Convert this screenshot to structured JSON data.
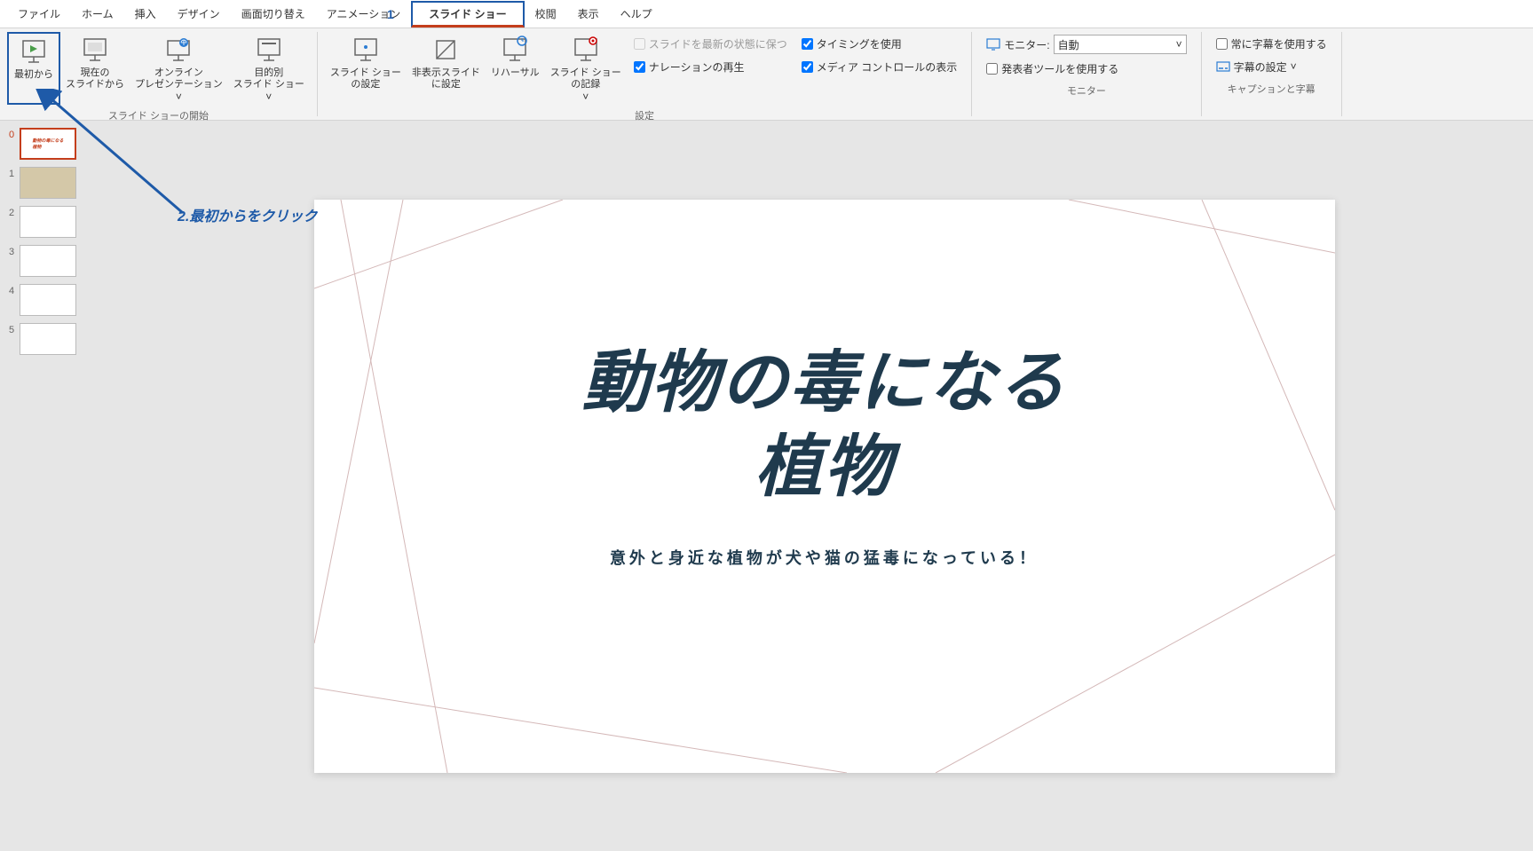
{
  "menubar": {
    "items": [
      "ファイル",
      "ホーム",
      "挿入",
      "デザイン",
      "画面切り替え",
      "アニメーション",
      "スライド ショー",
      "校閲",
      "表示",
      "ヘルプ"
    ],
    "active_index": 6,
    "annotation_1": "1"
  },
  "ribbon": {
    "start": {
      "from_beginning": "最初から",
      "from_current": "現在の\nスライドから",
      "online_presentation": "オンライン\nプレゼンテーション",
      "custom_show": "目的別\nスライド ショー",
      "group_label": "スライド ショーの開始"
    },
    "setup": {
      "setup_show": "スライド ショー\nの設定",
      "hide_slide": "非表示スライド\nに設定",
      "rehearse": "リハーサル",
      "record": "スライド ショー\nの記録",
      "keep_updated": "スライドを最新の状態に保つ",
      "narration": "ナレーションの再生",
      "timing": "タイミングを使用",
      "media_controls": "メディア コントロールの表示",
      "group_label": "設定"
    },
    "monitors": {
      "monitor_label": "モニター:",
      "monitor_value": "自動",
      "presenter_view": "発表者ツールを使用する",
      "group_label": "モニター"
    },
    "captions": {
      "always_subtitles": "常に字幕を使用する",
      "subtitle_settings": "字幕の設定",
      "group_label": "キャプションと字幕"
    }
  },
  "thumbs": [
    {
      "num": "0",
      "selected": true
    },
    {
      "num": "1",
      "selected": false
    },
    {
      "num": "2",
      "selected": false
    },
    {
      "num": "3",
      "selected": false
    },
    {
      "num": "4",
      "selected": false
    },
    {
      "num": "5",
      "selected": false
    }
  ],
  "slide": {
    "title": "動物の毒になる\n植物",
    "subtitle": "意外と身近な植物が犬や猫の猛毒になっている！"
  },
  "annotation": {
    "text": "2.最初からをクリック"
  }
}
